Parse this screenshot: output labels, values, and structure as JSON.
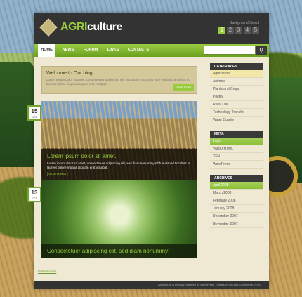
{
  "logo": {
    "agri": "AGRI",
    "culture": "culture"
  },
  "background_select": {
    "label": "Background Select",
    "options": [
      "1",
      "2",
      "3",
      "4",
      "5"
    ]
  },
  "nav": {
    "items": [
      "HOME",
      "NEWS",
      "FORUM",
      "LINKS",
      "CONTACTS"
    ]
  },
  "welcome": {
    "title": "Welcome to Our blog!",
    "text": "Lorem ipsum dolor sit amet, consectetuer adipiscing elit, sed diam nonummy nibh euismod tincidunt ut laoreet dolore magna aliquam erat volutpat.",
    "read_more": "read more"
  },
  "posts": [
    {
      "day": "15",
      "month": "oct",
      "title": "Lorem ipsum dolor sit amet.",
      "text": "Lorem ipsum dolor sit amet, consectetuer adipiscing elit, sed diam nonummy nibh euismod tincidunt ut laoreet dolore magna aliquam erat volutpat.",
      "comments": "[ 0 comments ]"
    },
    {
      "day": "13",
      "month": "oct",
      "title": "Consectetuer adipiscing elit, sed diam nonummy!"
    }
  ],
  "older_entries": "Older Entries",
  "sidebar": {
    "categories_title": "CATEGORIES",
    "categories": [
      "Agriculture",
      "Animals",
      "Plants and Crops",
      "Poetry",
      "Rural Life",
      "Technology Transfer",
      "Water Quality"
    ],
    "meta_title": "META",
    "meta": [
      "Login",
      "Valid XHTML",
      "XFN",
      "WordPress"
    ],
    "archives_title": "ARCHIVES",
    "archives": [
      "April 2008",
      "March 2008",
      "February 2008",
      "January 2008",
      "December 2007",
      "November 2007"
    ]
  },
  "footer": {
    "text": "Agriculture is proudly powered by WordPress. Entries (RSS) and Comments (RSS)."
  }
}
